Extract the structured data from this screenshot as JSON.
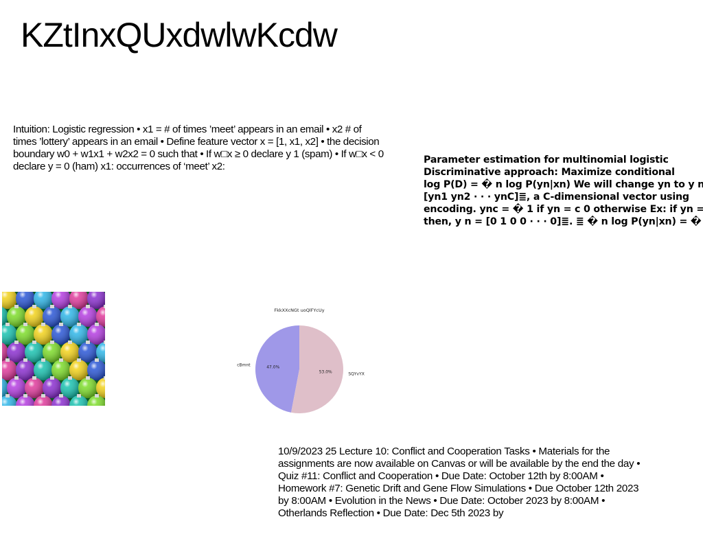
{
  "title": "KZtInxQUxdwlwKcdw",
  "left_text": "Intuition: Logistic regression • x1 = # of times ’meet’ appears in an email • x2 # of times ’lottery’ appears in an email • Define feature vector x = [1, x1, x2] • the decision boundary w0 + w1x1 + w2x2 = 0 such that • If w□x ≥ 0 declare y 1 (spam) • If w□x < 0 declare y = 0 (ham) x1: occurrences of ‘meet’ x2:",
  "right_text": {
    "line1": "Parameter estimation for multinomial logistic",
    "line2": "Discriminative approach: Maximize conditional",
    "line3": "log P(D) = � n log P(yn|xn) We will change yn to y n",
    "line4": "[yn1 yn2 · · · ynC]≣, a C-dimensional vector using",
    "line5": "encoding. ync = � 1 if yn = c 0 otherwise Ex: if yn =",
    "line6": "then, y n = [0 1 0 0 · · · 0]≣. ≣ � n log P(yn|xn) = � n"
  },
  "bottom_text": "10/9/2023 25 Lecture 10: Conflict and Cooperation Tasks • Materials for the assignments are now available on Canvas or will be available by the end the day • Quiz #11: Conflict and Cooperation • Due Date: October 12th by 8:00AM • Homework #7: Genetic Drift and Gene Flow Simulations • Due October 12th 2023 by 8:00AM • Evolution in the News • Due Date: October 2023 by 8:00AM • Otherlands Reflection • Due Date: Dec 5th 2023 by",
  "chart_data": {
    "type": "pie",
    "title": "FkkXXcNGt uoQlFYcUy",
    "labels": [
      "cBmnt",
      "SQYvYX"
    ],
    "values": [
      47.0,
      53.0
    ],
    "value_labels": [
      "47.0%",
      "53.0%"
    ],
    "colors": [
      "#9f98e8",
      "#dfbfc9"
    ],
    "start_angle_deg": 90,
    "direction": "counterclockwise"
  }
}
